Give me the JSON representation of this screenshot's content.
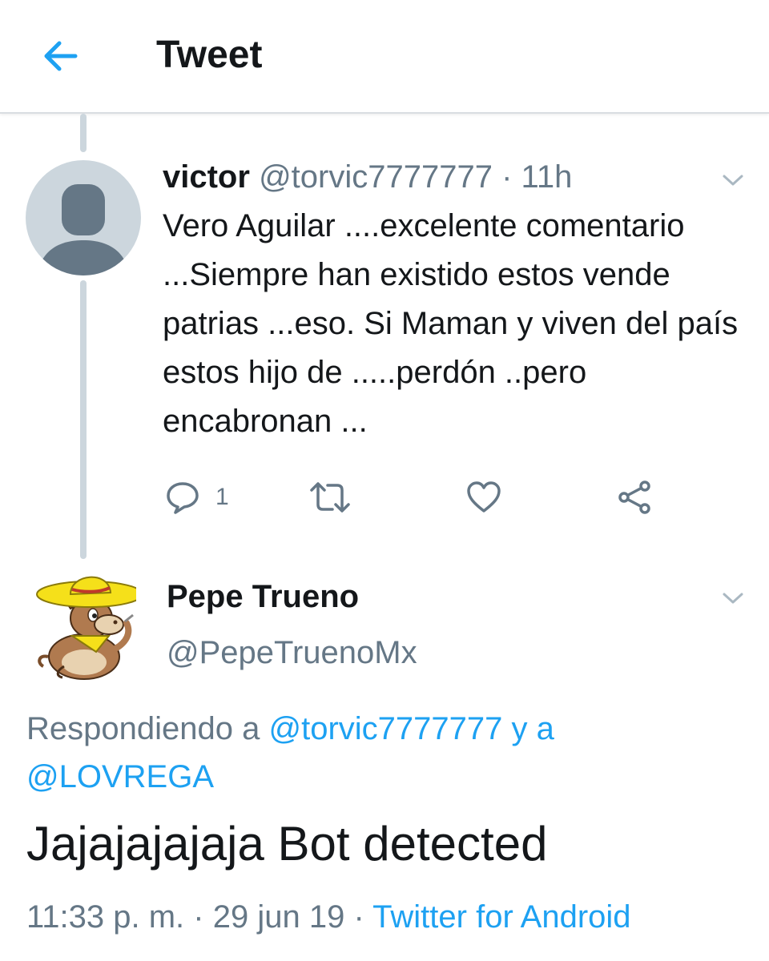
{
  "header": {
    "title": "Tweet",
    "back_icon": "arrow-left-icon",
    "accent_color": "#1da1f2"
  },
  "tweet1": {
    "name": "victor",
    "handle": "@torvic7777777",
    "separator": "·",
    "time": "11h",
    "text": "Vero Aguilar ....excelente comentario ...Siempre han existido estos vende patrias ...eso. Si Maman y viven del país estos hijo de .....perdón ..pero encabronan ...",
    "reply_count": "1",
    "avatar": "default-profile-avatar"
  },
  "tweet2": {
    "name": "Pepe Trueno",
    "handle": "@PepeTruenoMx",
    "replying_prefix": "Respondiendo a",
    "reply_user1": "@torvic7777777",
    "reply_joiner": "y a",
    "reply_user2": "@LOVREGA",
    "text": "Jajajajajaja Bot detected",
    "timestamp": "11:33 p. m.",
    "sep1": "·",
    "date": "29 jun 19",
    "sep2": "·",
    "source": "Twitter for Android",
    "avatar": "donkey-sombrero-avatar"
  }
}
